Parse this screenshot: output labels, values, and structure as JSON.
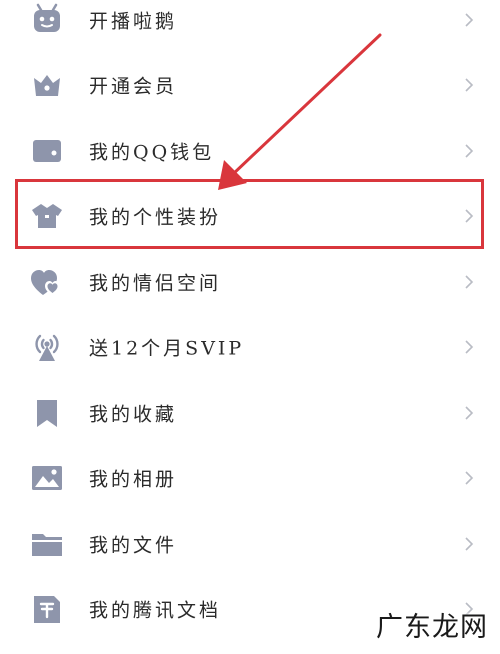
{
  "menu": {
    "items": [
      {
        "label": "开播啦鹅",
        "icon": "robot-icon"
      },
      {
        "label": "开通会员",
        "icon": "crown-icon"
      },
      {
        "label": "我的QQ钱包",
        "icon": "wallet-icon"
      },
      {
        "label": "我的个性装扮",
        "icon": "tshirt-icon"
      },
      {
        "label": "我的情侣空间",
        "icon": "hearts-icon"
      },
      {
        "label": "送12个月SVIP",
        "icon": "signal-tower-icon"
      },
      {
        "label": "我的收藏",
        "icon": "bookmark-icon"
      },
      {
        "label": "我的相册",
        "icon": "photo-icon"
      },
      {
        "label": "我的文件",
        "icon": "folder-icon"
      },
      {
        "label": "我的腾讯文档",
        "icon": "doc-icon"
      }
    ]
  },
  "annotation": {
    "highlighted_item": "我的个性装扮",
    "color": "#d9363c"
  },
  "watermark": {
    "text": "广东龙网"
  },
  "colors": {
    "icon": "#8e95ab",
    "chevron": "#b9bcc4",
    "text": "#2b2b2b"
  }
}
